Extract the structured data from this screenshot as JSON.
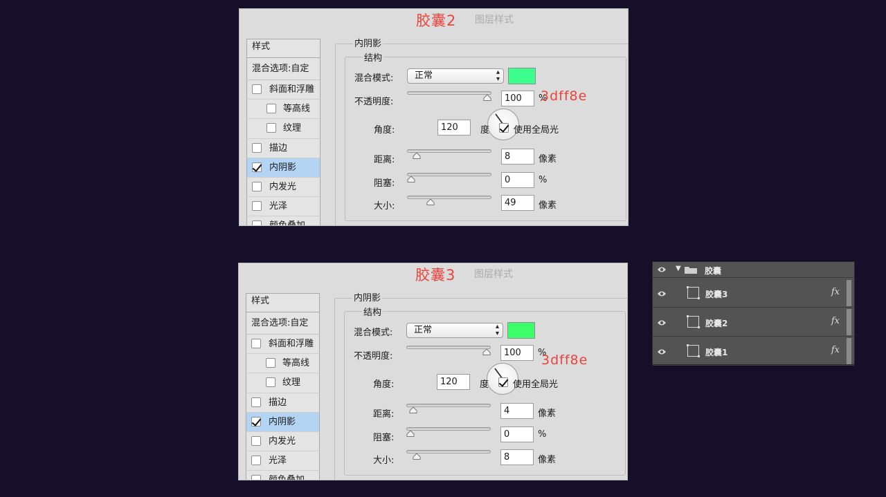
{
  "dialogs": [
    {
      "id": "dlg2",
      "title_annotation": "胶囊2",
      "title": "图层样式",
      "sidebar": {
        "header": "样式",
        "blend_options": "混合选项:自定",
        "items": [
          {
            "label": "斜面和浮雕",
            "checked": false,
            "indent": false,
            "selected": false
          },
          {
            "label": "等高线",
            "checked": false,
            "indent": true,
            "selected": false
          },
          {
            "label": "纹理",
            "checked": false,
            "indent": true,
            "selected": false
          },
          {
            "label": "描边",
            "checked": false,
            "indent": false,
            "selected": false
          },
          {
            "label": "内阴影",
            "checked": true,
            "indent": false,
            "selected": true
          },
          {
            "label": "内发光",
            "checked": false,
            "indent": false,
            "selected": false
          },
          {
            "label": "光泽",
            "checked": false,
            "indent": false,
            "selected": false
          },
          {
            "label": "颜色叠加",
            "checked": false,
            "indent": false,
            "selected": false
          }
        ]
      },
      "settings": {
        "section": "内阴影",
        "group": "结构",
        "blend_mode_label": "混合模式:",
        "blend_mode_value": "正常",
        "color": "#3dff8e",
        "opacity_label": "不透明度:",
        "opacity_value": "100",
        "opacity_unit": "%",
        "hex_annotation": "3dff8e",
        "angle_label": "角度:",
        "angle_value": "120",
        "angle_unit": "度",
        "global_light_label": "使用全局光",
        "global_light_checked": true,
        "distance_label": "距离:",
        "distance_value": "8",
        "distance_unit": "像素",
        "choke_label": "阻塞:",
        "choke_value": "0",
        "choke_unit": "%",
        "size_label": "大小:",
        "size_value": "49",
        "size_unit": "像素",
        "slider_levels": {
          "opacity": 1.0,
          "distance": 0.07,
          "choke": 0.0,
          "size": 0.25
        }
      }
    },
    {
      "id": "dlg3",
      "title_annotation": "胶囊3",
      "title": "图层样式",
      "sidebar": {
        "header": "样式",
        "blend_options": "混合选项:自定",
        "items": [
          {
            "label": "斜面和浮雕",
            "checked": false,
            "indent": false,
            "selected": false
          },
          {
            "label": "等高线",
            "checked": false,
            "indent": true,
            "selected": false
          },
          {
            "label": "纹理",
            "checked": false,
            "indent": true,
            "selected": false
          },
          {
            "label": "描边",
            "checked": false,
            "indent": false,
            "selected": false
          },
          {
            "label": "内阴影",
            "checked": true,
            "indent": false,
            "selected": true
          },
          {
            "label": "内发光",
            "checked": false,
            "indent": false,
            "selected": false
          },
          {
            "label": "光泽",
            "checked": false,
            "indent": false,
            "selected": false
          },
          {
            "label": "颜色叠加",
            "checked": false,
            "indent": false,
            "selected": false
          }
        ]
      },
      "settings": {
        "section": "内阴影",
        "group": "结构",
        "blend_mode_label": "混合模式:",
        "blend_mode_value": "正常",
        "color": "#3dff6a",
        "opacity_label": "不透明度:",
        "opacity_value": "100",
        "opacity_unit": "%",
        "hex_annotation": "3dff8e",
        "angle_label": "角度:",
        "angle_value": "120",
        "angle_unit": "度",
        "global_light_label": "使用全局光",
        "global_light_checked": true,
        "distance_label": "距离:",
        "distance_value": "4",
        "distance_unit": "像素",
        "choke_label": "阻塞:",
        "choke_value": "0",
        "choke_unit": "%",
        "size_label": "大小:",
        "size_value": "8",
        "size_unit": "像素",
        "slider_levels": {
          "opacity": 1.0,
          "distance": 0.04,
          "choke": 0.0,
          "size": 0.08
        }
      }
    }
  ],
  "layers": {
    "group": {
      "name": "胶囊",
      "icon": "folder-icon"
    },
    "items": [
      {
        "name": "胶囊3",
        "fx": "fx"
      },
      {
        "name": "胶囊2",
        "fx": "fx"
      },
      {
        "name": "胶囊1",
        "fx": "fx"
      }
    ]
  },
  "colors": {
    "background": "#170f29",
    "annotation_red": "#e8443c",
    "selected_row": "#b4d4f4",
    "layers_panel": "#535353"
  }
}
